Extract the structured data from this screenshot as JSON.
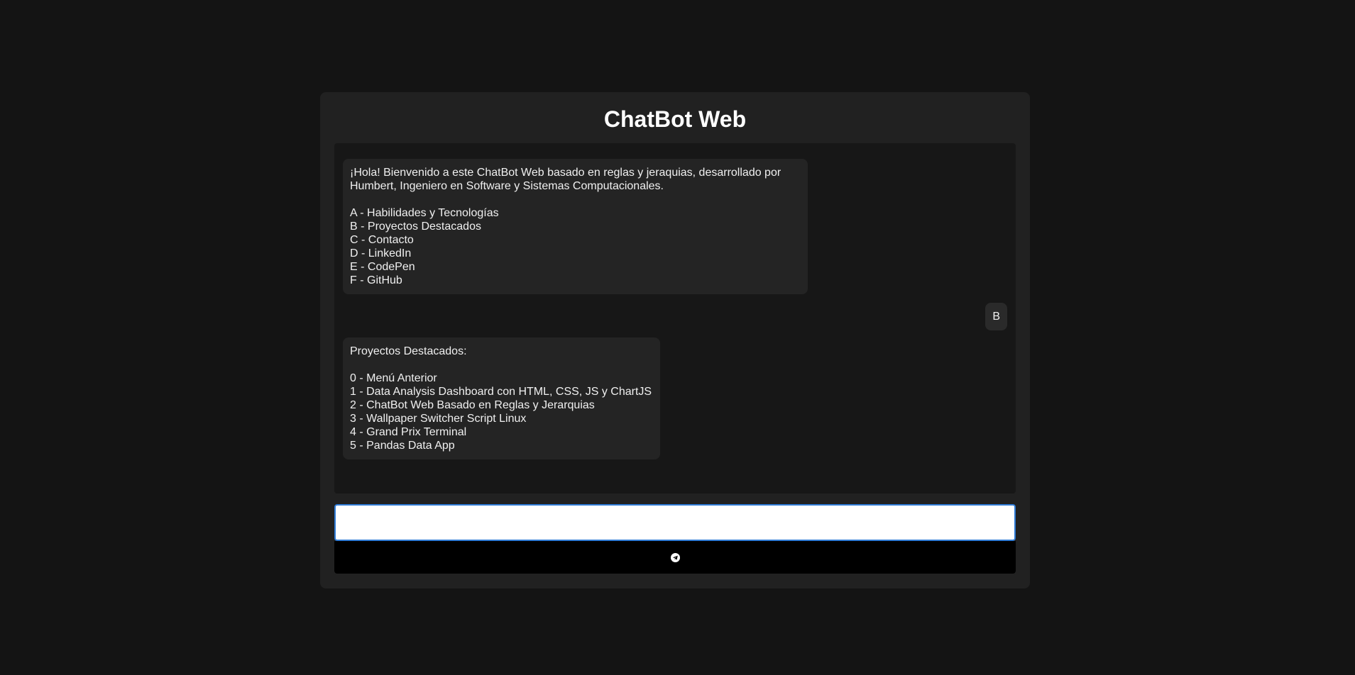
{
  "header": {
    "title": "ChatBot Web"
  },
  "messages": [
    {
      "sender": "bot",
      "text": "¡Hola! Bienvenido a este ChatBot Web basado en reglas y jeraquias, desarrollado por Humbert, Ingeniero en Software y Sistemas Computacionales.\n\nA - Habilidades y Tecnologías\nB - Proyectos Destacados\nC - Contacto\nD - LinkedIn\nE - CodePen\nF - GitHub"
    },
    {
      "sender": "user",
      "text": "B"
    },
    {
      "sender": "bot",
      "text": "Proyectos Destacados:\n\n0 - Menú Anterior\n1 - Data Analysis Dashboard con HTML, CSS, JS y ChartJS\n2 - ChatBot Web Basado en Reglas y Jerarquias\n3 - Wallpaper Switcher Script Linux\n4 - Grand Prix Terminal\n5 - Pandas Data App"
    }
  ],
  "input": {
    "value": "",
    "placeholder": ""
  },
  "send_button": {
    "icon": "send-icon"
  },
  "colors": {
    "page_background": "#141414",
    "card_background": "#212121",
    "messages_background": "#171717",
    "bubble_background": "#242424",
    "input_focus_border": "#2f7bd6",
    "send_button_background": "#000000"
  }
}
